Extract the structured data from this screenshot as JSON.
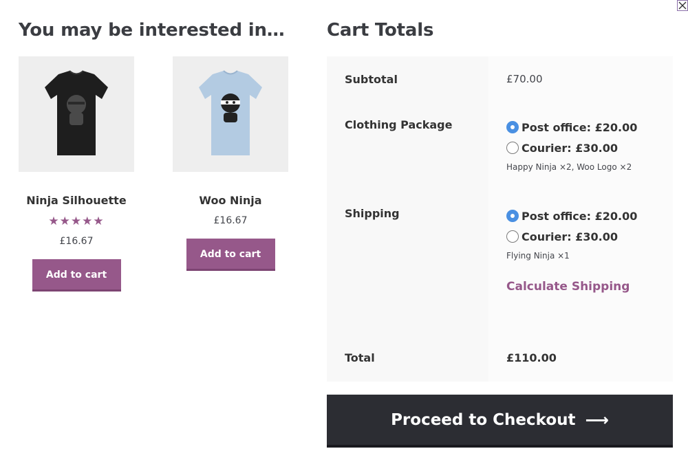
{
  "modal": {
    "close_icon": "close-icon"
  },
  "related": {
    "heading": "You may be interested in…",
    "products": [
      {
        "name": "Ninja Silhouette",
        "rating_stars": "★★★★★",
        "rating": 5,
        "price": "£16.67",
        "button": "Add to cart",
        "shirt_color": "#1e1e1e"
      },
      {
        "name": "Woo Ninja",
        "price": "£16.67",
        "button": "Add to cart",
        "shirt_color": "#b3cbe2"
      }
    ]
  },
  "cart_totals": {
    "heading": "Cart Totals",
    "subtotal": {
      "label": "Subtotal",
      "value": "£70.00"
    },
    "clothing_package": {
      "label": "Clothing Package",
      "options": [
        {
          "text": "Post office: £20.00",
          "selected": true
        },
        {
          "text": "Courier: £30.00",
          "selected": false
        }
      ],
      "items": "Happy Ninja ×2, Woo Logo ×2"
    },
    "shipping": {
      "label": "Shipping",
      "options": [
        {
          "text": "Post office: £20.00",
          "selected": true
        },
        {
          "text": "Courier: £30.00",
          "selected": false
        }
      ],
      "items": "Flying Ninja ×1",
      "calculate_link": "Calculate Shipping"
    },
    "total": {
      "label": "Total",
      "value": "£110.00"
    }
  },
  "checkout": {
    "label": "Proceed to Checkout",
    "arrow": "⟶"
  },
  "colors": {
    "accent": "#96588a",
    "dark": "#2c2d33",
    "radio_selected": "#4a90e2"
  }
}
